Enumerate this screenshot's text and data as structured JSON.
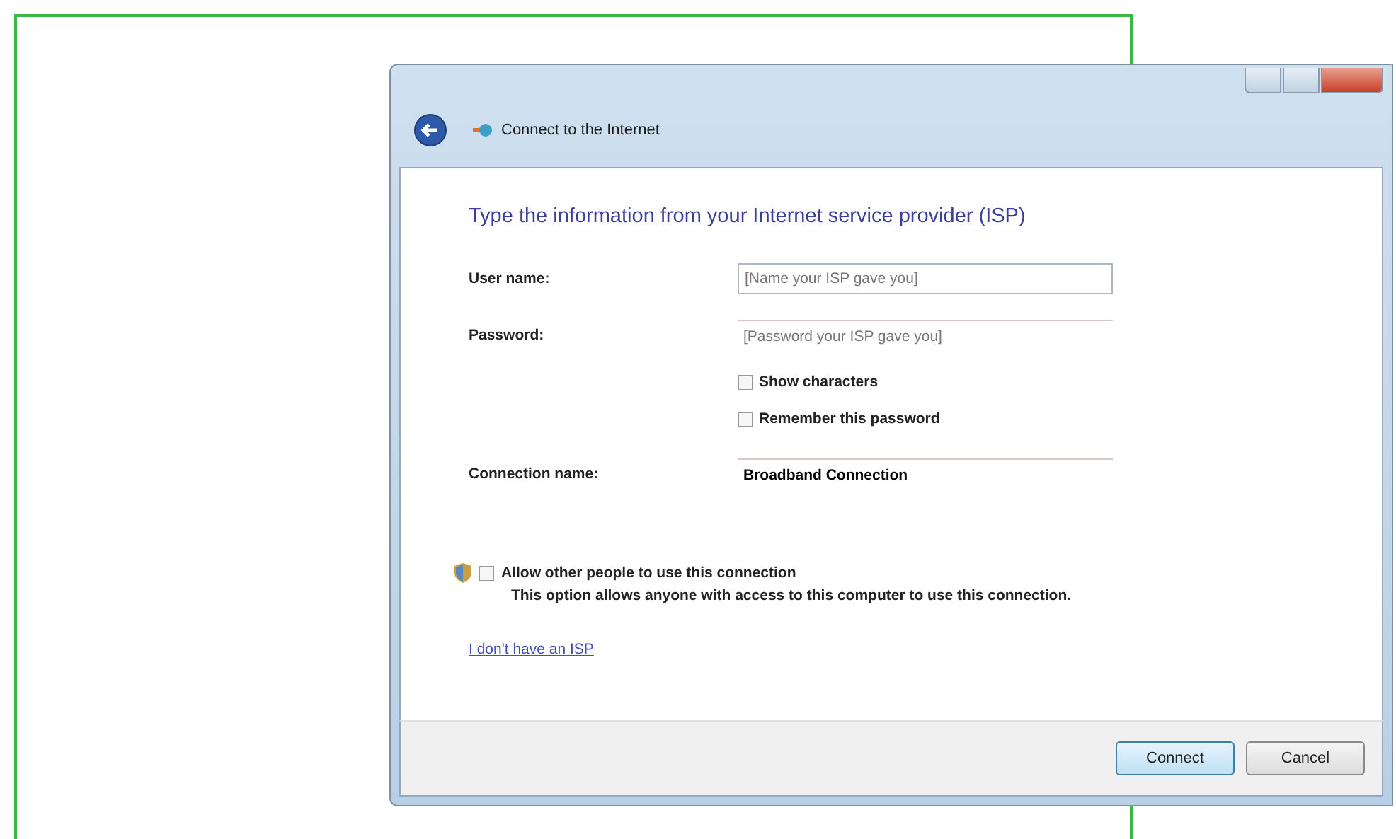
{
  "window": {
    "title": "Connect to the Internet"
  },
  "heading": "Type the information from your Internet service provider (ISP)",
  "fields": [
    {
      "label": "User name:",
      "placeholder": "[Name your ISP gave you]",
      "boxed": true
    },
    {
      "label": "Password:",
      "placeholder": "[Password your ISP gave you]",
      "boxed": false
    }
  ],
  "options": [
    {
      "label": "Show characters",
      "checked": false
    },
    {
      "label": "Remember this password",
      "checked": false
    }
  ],
  "connection_name": {
    "label": "Connection name:",
    "value": "Broadband Connection"
  },
  "sharing": {
    "label": "Allow other people to use this connection",
    "checked": false,
    "description": "This option allows anyone with access to this computer to use this connection."
  },
  "link": "I don't have an ISP",
  "buttons": [
    {
      "label": "Connect",
      "default": true
    },
    {
      "label": "Cancel",
      "default": false
    }
  ]
}
